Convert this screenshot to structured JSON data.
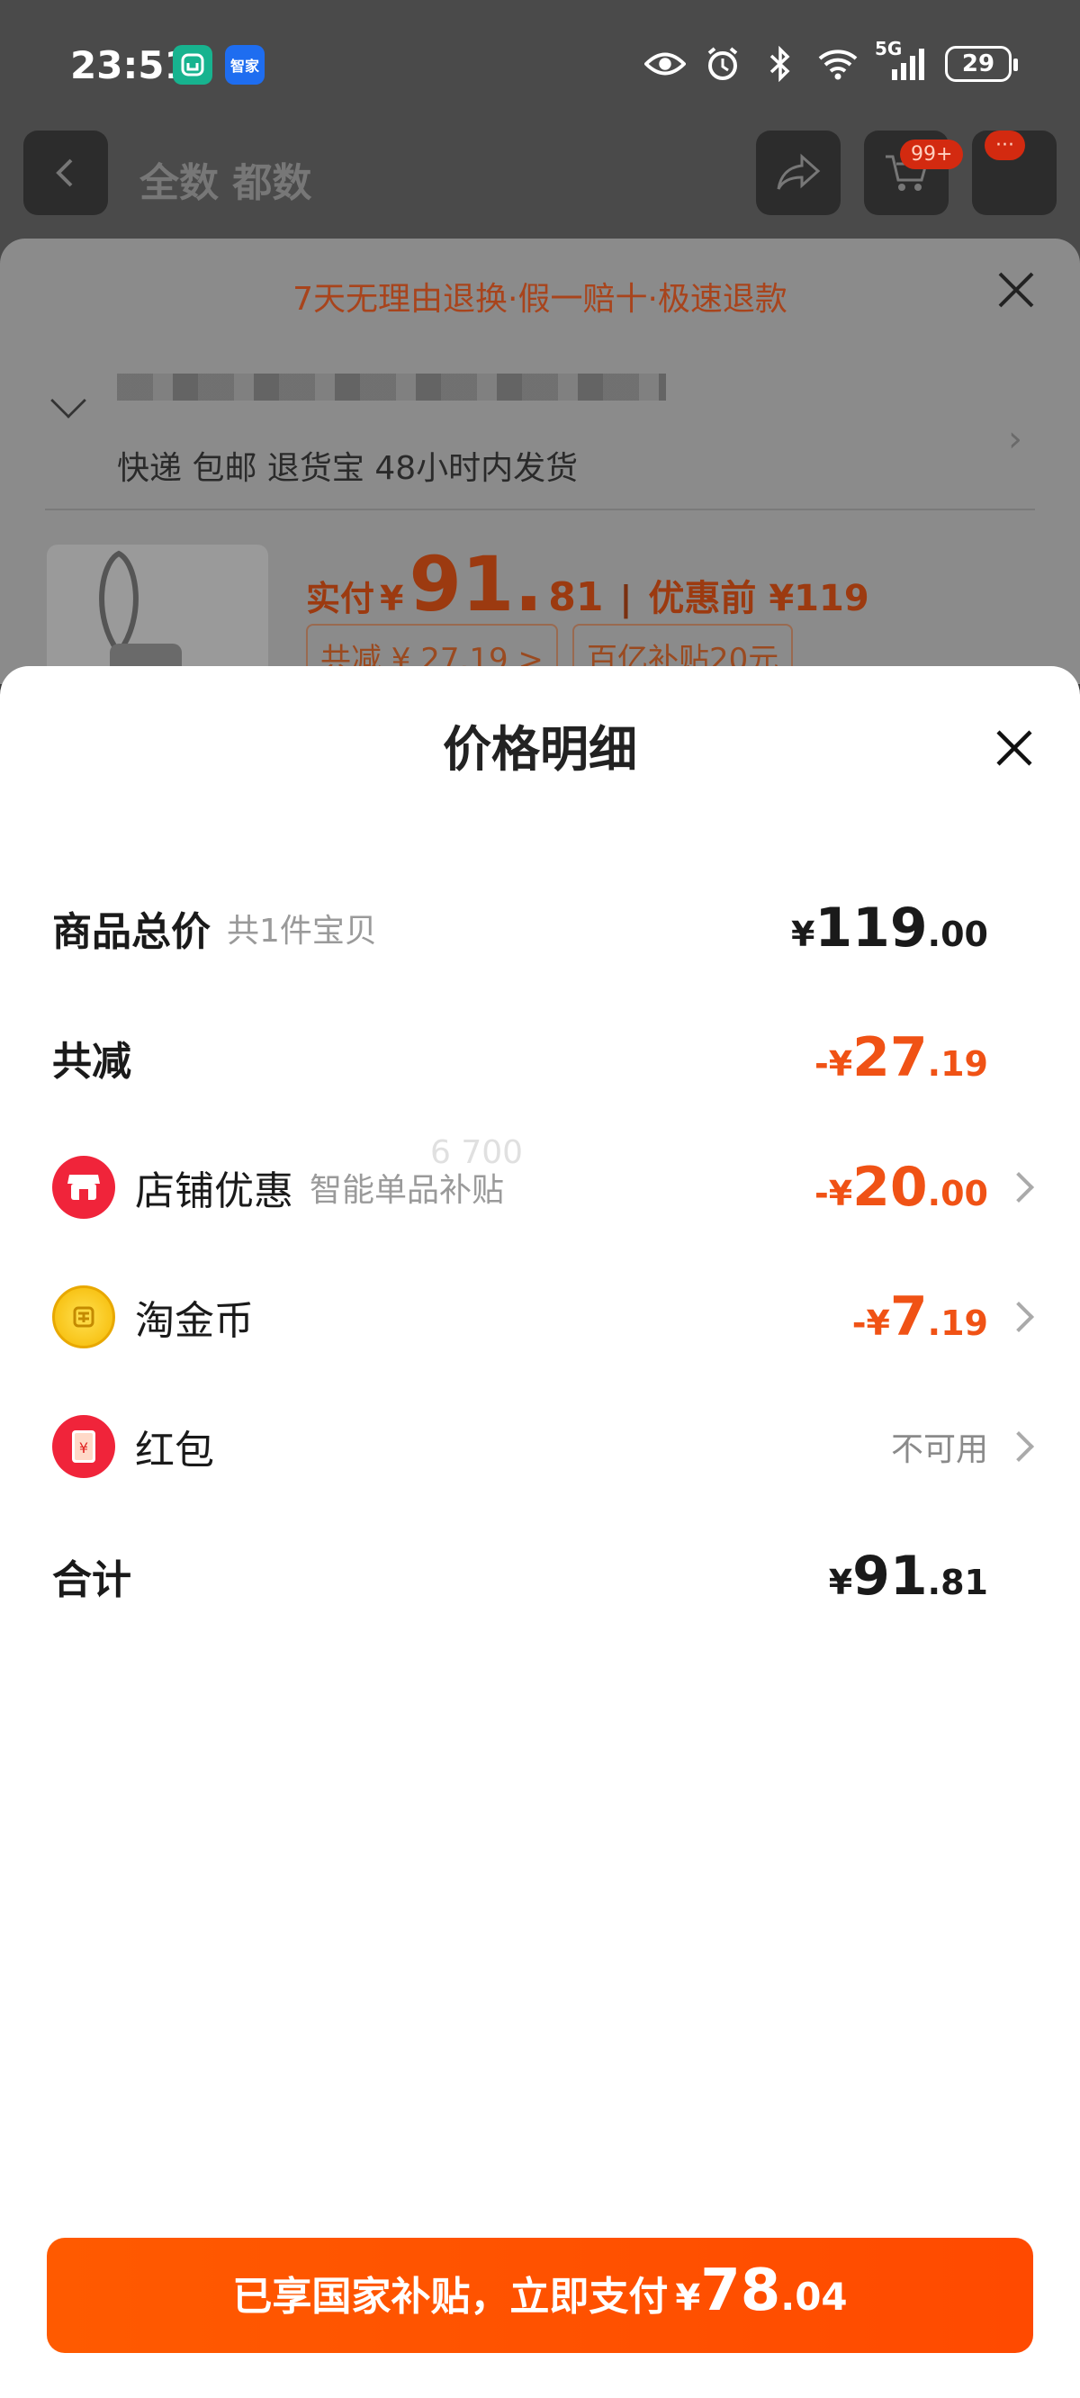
{
  "status_bar": {
    "time": "23:51",
    "apps": [
      "mi-home-icon",
      "smart-home-icon"
    ],
    "smart_home_label": "智家",
    "network": "5G",
    "battery": "29"
  },
  "bg_page": {
    "nav_title": "全数 都数",
    "cart_badge": "99+",
    "more_badge": "···",
    "promo": "7天无理由退换·假一赔十·极速退款",
    "shipping": "快递 包邮 退货宝 48小时内发货",
    "paid_label": "实付",
    "currency": "¥",
    "paid_int": "91.",
    "paid_dec": "81",
    "separator": "|",
    "pre_price": "优惠前 ¥119",
    "tag_total_off": "共减 ¥ 27.19 >",
    "tag_subsidy": "百亿补贴20元"
  },
  "sheet": {
    "title": "价格明细",
    "rows": {
      "total": {
        "label": "商品总价",
        "sub": "共1件宝贝",
        "sym": "¥",
        "int": "119",
        "dec": ".00"
      },
      "reduced": {
        "label": "共减",
        "sym": "-¥",
        "int": "27",
        "dec": ".19"
      },
      "shop": {
        "label": "店铺优惠",
        "sub": "智能单品补贴",
        "sym": "-¥",
        "int": "20",
        "dec": ".00"
      },
      "coin": {
        "label": "淘金币",
        "sym": "-¥",
        "int": "7",
        "dec": ".19"
      },
      "redpack": {
        "label": "红包",
        "value": "不可用"
      },
      "sum": {
        "label": "合计",
        "sym": "¥",
        "int": "91",
        "dec": ".81"
      }
    },
    "watermark": "6 700"
  },
  "pay_button": {
    "text": "已享国家补贴，立即支付",
    "sym": "¥",
    "int": "78",
    "dec": ".04"
  },
  "colors": {
    "accent": "#FF5000",
    "negative": "#F05215"
  }
}
